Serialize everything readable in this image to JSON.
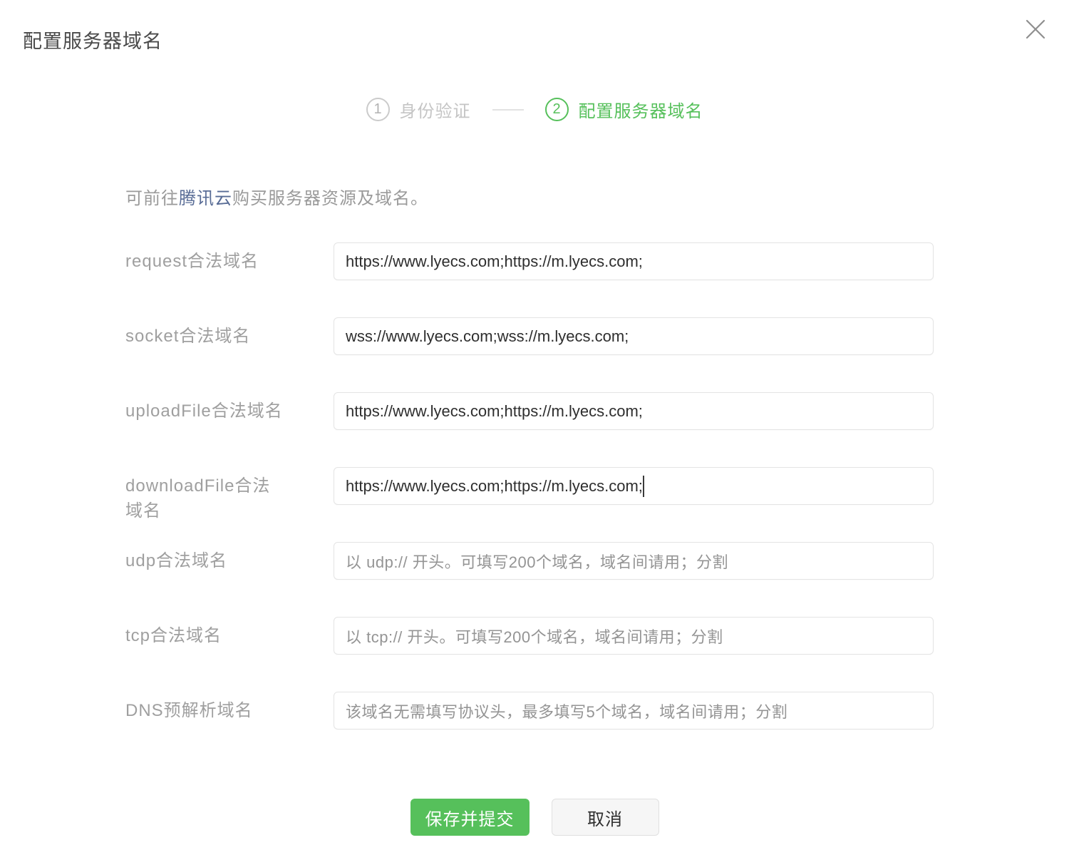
{
  "dialog": {
    "title": "配置服务器域名"
  },
  "stepper": {
    "steps": [
      {
        "number": "1",
        "label": "身份验证",
        "state": "inactive"
      },
      {
        "number": "2",
        "label": "配置服务器域名",
        "state": "active"
      }
    ]
  },
  "notice": {
    "prefix": "可前往",
    "link": "腾讯云",
    "suffix": "购买服务器资源及域名。"
  },
  "form": {
    "rows": [
      {
        "label": "request合法域名",
        "value": "https://www.lyecs.com;https://m.lyecs.com;",
        "placeholder": ""
      },
      {
        "label": "socket合法域名",
        "value": "wss://www.lyecs.com;wss://m.lyecs.com;",
        "placeholder": ""
      },
      {
        "label": "uploadFile合法域名",
        "value": "https://www.lyecs.com;https://m.lyecs.com;",
        "placeholder": ""
      },
      {
        "label": "downloadFile合法域名",
        "value": "https://www.lyecs.com;https://m.lyecs.com;",
        "placeholder": "",
        "focused": true
      },
      {
        "label": "udp合法域名",
        "value": "",
        "placeholder": "以 udp:// 开头。可填写200个域名，域名间请用；分割"
      },
      {
        "label": "tcp合法域名",
        "value": "",
        "placeholder": "以 tcp:// 开头。可填写200个域名，域名间请用；分割"
      },
      {
        "label": "DNS预解析域名",
        "value": "",
        "placeholder": "该域名无需填写协议头，最多填写5个域名，域名间请用；分割"
      }
    ]
  },
  "actions": {
    "submit_label": "保存并提交",
    "cancel_label": "取消"
  },
  "colors": {
    "accent_green": "#56c05b",
    "link_blue": "#576b95",
    "label_gray": "#9f9f9f",
    "inactive_gray": "#c5c5c5",
    "input_border": "#e4e4e4",
    "input_text": "#2e2e2e"
  }
}
